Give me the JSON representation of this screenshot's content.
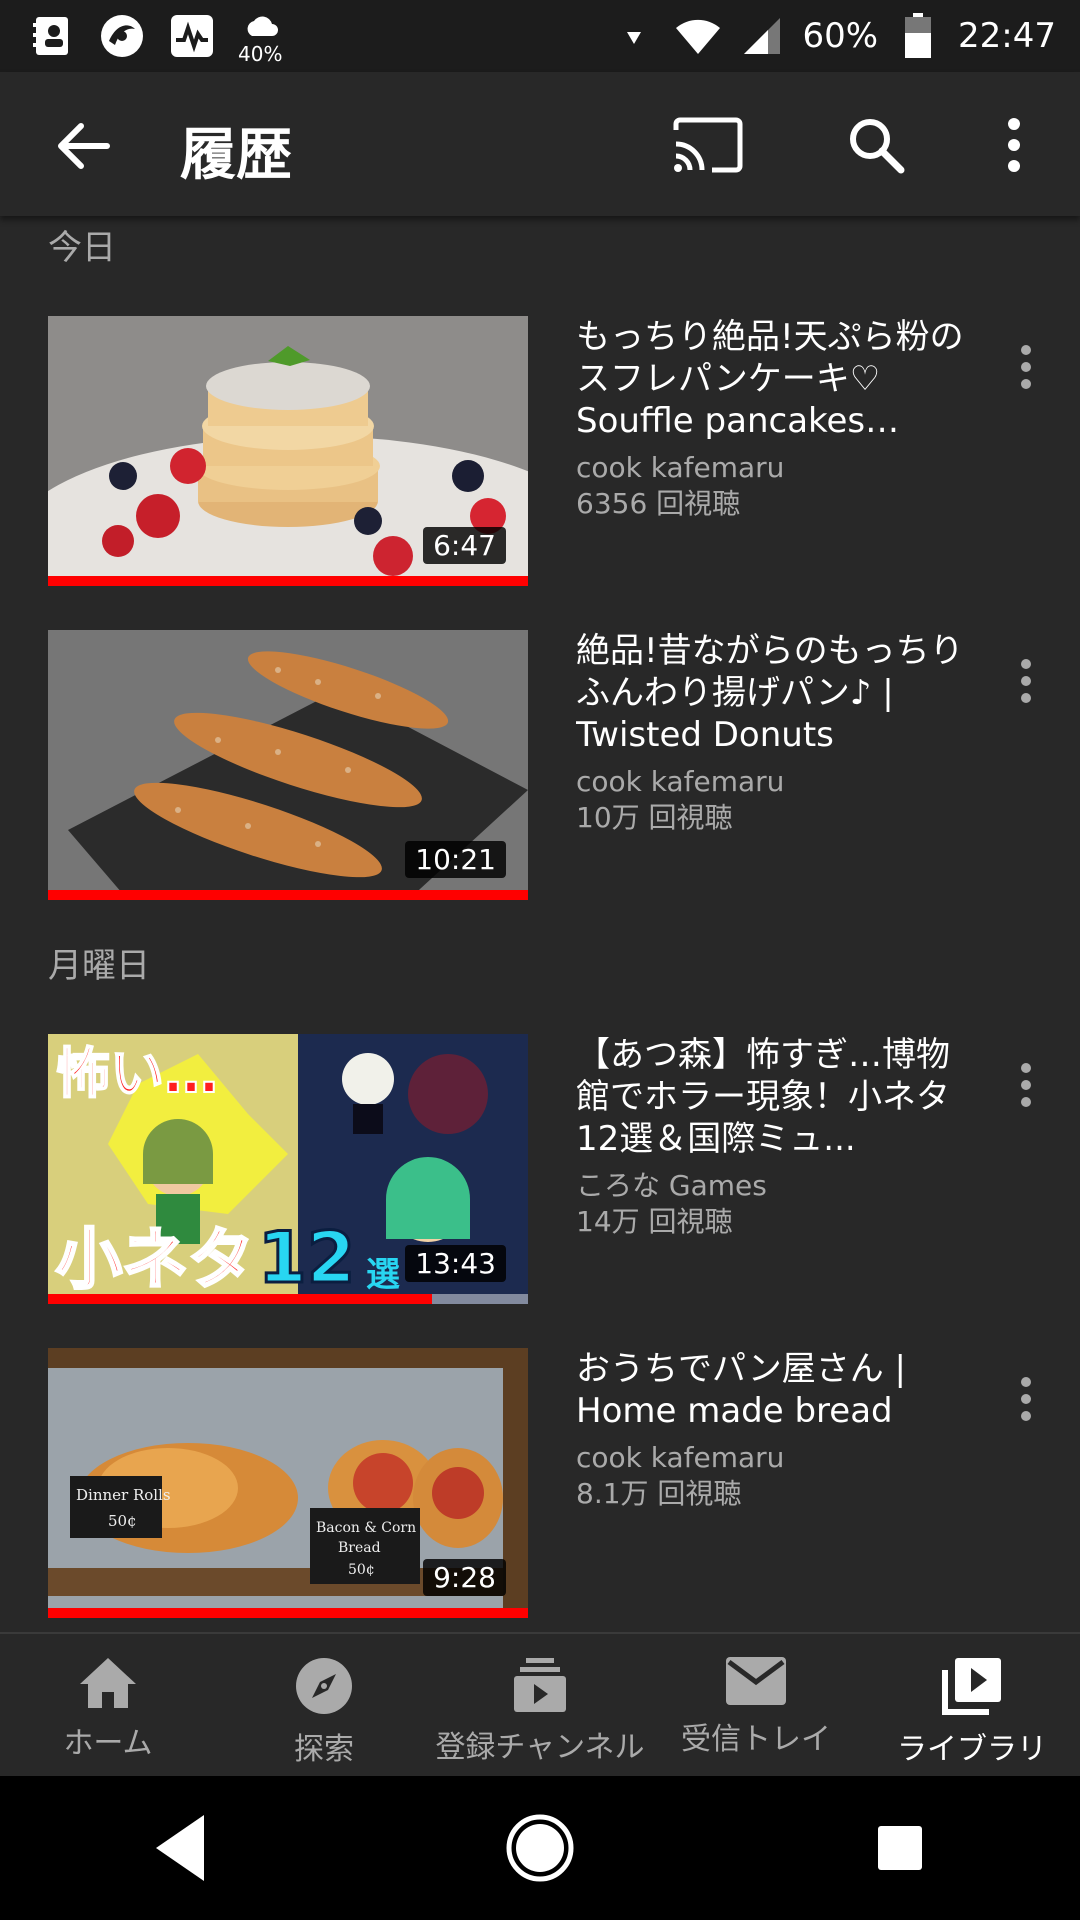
{
  "status_bar": {
    "weather_percent": "40%",
    "battery_percent": "60%",
    "time": "22:47",
    "icons": [
      "contacts-icon",
      "app-icon",
      "activity-icon",
      "weather-icon",
      "signal-arrow-icon",
      "wifi-icon",
      "cell-signal-icon",
      "battery-icon"
    ]
  },
  "app_bar": {
    "title": "履歴",
    "icons": [
      "back-arrow-icon",
      "cast-icon",
      "search-icon",
      "more-vert-icon"
    ]
  },
  "sections": [
    {
      "header": "今日",
      "videos": [
        {
          "title": "もっちり絶品!天ぷら粉のスフレパンケーキ♡ Souffle pancakes with...",
          "channel": "cook kafemaru",
          "views": "6356 回視聴",
          "duration": "6:47",
          "progress": 1.0,
          "thumb_colors": [
            "#d9d6d2",
            "#e8c68e",
            "#c4282d"
          ]
        },
        {
          "title": "絶品!昔ながらのもっちりふんわり揚げパン♪ | Twisted Donuts",
          "channel": "cook kafemaru",
          "views": "10万 回視聴",
          "duration": "10:21",
          "progress": 1.0,
          "thumb_colors": [
            "#6f6f6f",
            "#2d2d2d",
            "#c47a3a"
          ]
        }
      ]
    },
    {
      "header": "月曜日",
      "videos": [
        {
          "title": "【あつ森】怖すぎ…博物館でホラー現象！小ネタ12選＆国際ミュ...",
          "channel": "ころな Games",
          "views": "14万 回視聴",
          "duration": "13:43",
          "progress": 0.8,
          "thumb_colors": [
            "#e8e34a",
            "#1f2d55",
            "#ff2a2a"
          ]
        },
        {
          "title": "おうちでパン屋さん | Home made bread",
          "channel": "cook kafemaru",
          "views": "8.1万 回視聴",
          "duration": "9:28",
          "progress": 1.0,
          "thumb_colors": [
            "#9aa2a8",
            "#6b4a2b",
            "#d88c3c"
          ]
        }
      ]
    }
  ],
  "bottom_nav": [
    {
      "label": "ホーム",
      "icon": "home-icon",
      "active": false
    },
    {
      "label": "探索",
      "icon": "explore-icon",
      "active": false
    },
    {
      "label": "登録チャンネル",
      "icon": "subscriptions-icon",
      "active": false
    },
    {
      "label": "受信トレイ",
      "icon": "inbox-icon",
      "active": false
    },
    {
      "label": "ライブラリ",
      "icon": "library-icon",
      "active": true
    }
  ],
  "colors": {
    "background": "#282828",
    "status_bar": "#1c1c1c",
    "progress": "#ff0000",
    "secondary_text": "#aaaaaa"
  }
}
